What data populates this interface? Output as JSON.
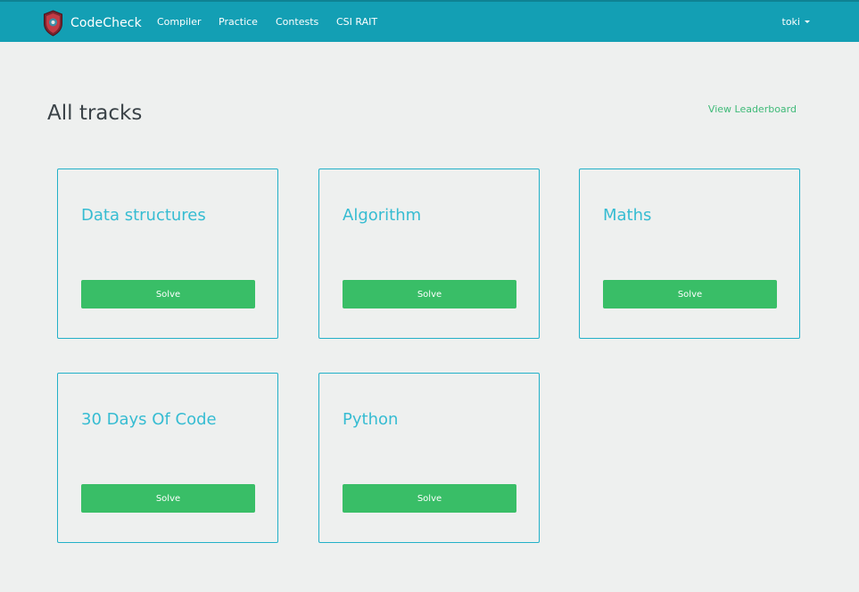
{
  "colors": {
    "nav_bg": "#139fb4",
    "page_bg": "#eef0ef",
    "accent_cyan": "#36bcd2",
    "button_green": "#39be67",
    "link_green": "#3fba78"
  },
  "navbar": {
    "brand": "CodeCheck",
    "logo_icon": "shield-logo-icon",
    "items": [
      {
        "label": "Compiler"
      },
      {
        "label": "Practice"
      },
      {
        "label": "Contests"
      },
      {
        "label": "CSI RAIT"
      }
    ],
    "user": {
      "name": "toki",
      "icon": "caret-down-icon"
    }
  },
  "main": {
    "title": "All tracks",
    "leaderboard_link": "View Leaderboard",
    "tracks": [
      {
        "name": "Data structures",
        "button": "Solve"
      },
      {
        "name": "Algorithm",
        "button": "Solve"
      },
      {
        "name": "Maths",
        "button": "Solve"
      },
      {
        "name": "30 Days Of Code",
        "button": "Solve"
      },
      {
        "name": "Python",
        "button": "Solve"
      }
    ]
  }
}
